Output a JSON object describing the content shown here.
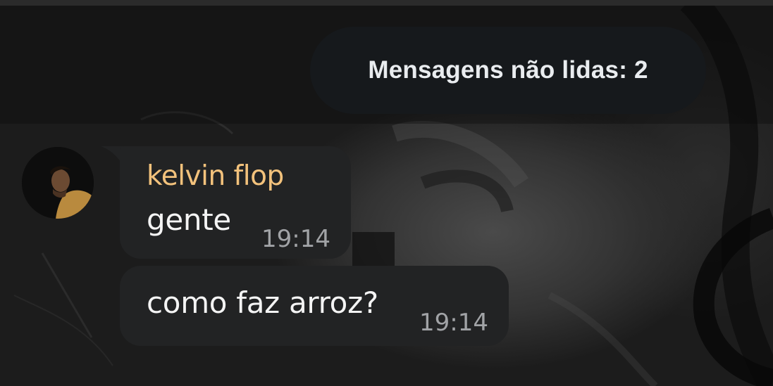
{
  "unread_banner": {
    "text": "Mensagens não lidas: 2"
  },
  "messages": [
    {
      "sender": "kelvin flop",
      "text": "gente",
      "time": "19:14"
    },
    {
      "text": "como faz arroz?",
      "time": "19:14"
    }
  ],
  "colors": {
    "sender_name": "#f3c27c",
    "bubble": "#222324",
    "unread_pill": "#16191c"
  },
  "icons": {
    "avatar": "user-avatar-photo"
  }
}
